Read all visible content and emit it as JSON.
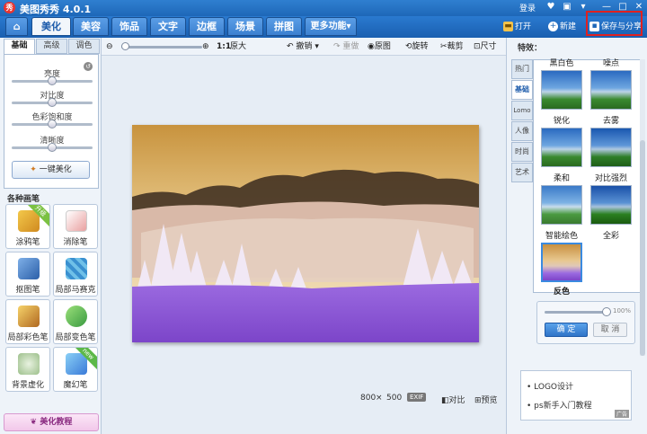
{
  "app": {
    "title": "美图秀秀 4.0.1",
    "logo_char": "秀",
    "login": "登录"
  },
  "nav": {
    "tabs": [
      "美化",
      "美容",
      "饰品",
      "文字",
      "边框",
      "场景",
      "拼图",
      "更多功能"
    ],
    "more_arrow": "▾",
    "open": "打开",
    "new": "新建",
    "save_share": "保存与分享"
  },
  "left": {
    "subtabs": [
      "基础",
      "高级",
      "调色"
    ],
    "sliders": [
      "亮度",
      "对比度",
      "色彩饱和度",
      "清晰度"
    ],
    "onekey": "一键美化",
    "section_title": "各种画笔",
    "tools": [
      {
        "label": "涂鸦笔",
        "badge": "升级"
      },
      {
        "label": "消除笔",
        "badge": ""
      },
      {
        "label": "抠图笔",
        "badge": ""
      },
      {
        "label": "局部马赛克",
        "badge": ""
      },
      {
        "label": "局部彩色笔",
        "badge": ""
      },
      {
        "label": "局部变色笔",
        "badge": ""
      },
      {
        "label": "背景虚化",
        "badge": ""
      },
      {
        "label": "魔幻笔",
        "badge": "new"
      }
    ],
    "tutorial": "美化教程"
  },
  "toolbar": {
    "ratio": "1:1",
    "original": "原大",
    "undo": "撤销",
    "redo": "重做",
    "original_image": "原图",
    "rotate": "旋转",
    "crop": "裁剪",
    "size": "尺寸"
  },
  "status": {
    "width": "800",
    "times": "×",
    "height": "500",
    "exif": "EXIF",
    "compare": "对比",
    "preview": "预览"
  },
  "right": {
    "title": "特效：",
    "vtabs": [
      "热门",
      "基础",
      "Lomo",
      "人像",
      "时尚",
      "艺术"
    ],
    "effects": [
      "黑白色",
      "噪点",
      "锐化",
      "去雾",
      "柔和",
      "对比强烈",
      "智能绘色",
      "全彩",
      "反色"
    ],
    "percent": "100%",
    "ok": "确 定",
    "cancel": "取 消",
    "links": [
      "LOGO设计",
      "ps新手入门教程"
    ],
    "ad": "广告"
  },
  "colors": {
    "accent": "#1e67b8",
    "save_highlight": "#e02020",
    "invert_violet": "#8b56d8"
  }
}
